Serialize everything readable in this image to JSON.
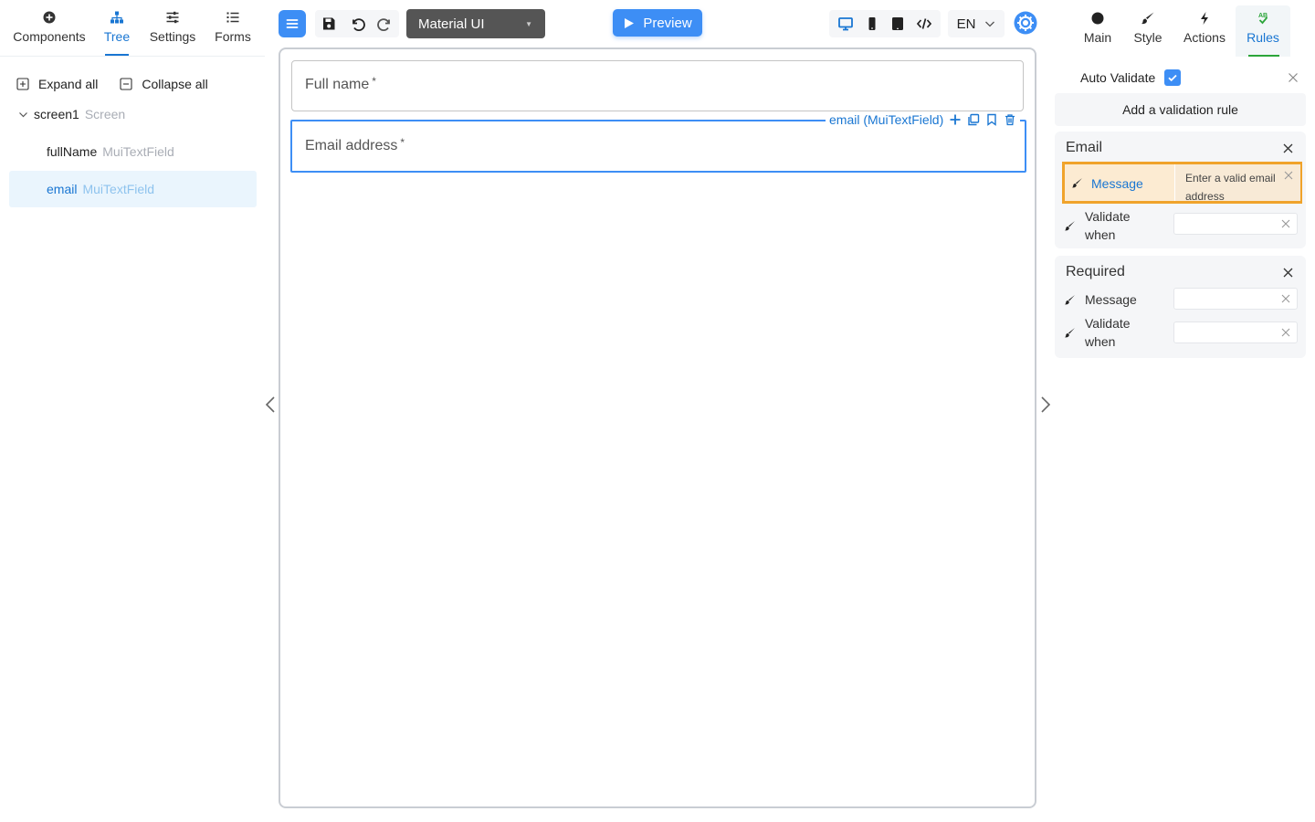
{
  "left_panel": {
    "tabs": [
      {
        "label": "Components",
        "icon": "plus-circle-icon"
      },
      {
        "label": "Tree",
        "icon": "sitemap-icon",
        "active": true
      },
      {
        "label": "Settings",
        "icon": "sliders-icon"
      },
      {
        "label": "Forms",
        "icon": "list-icon"
      }
    ],
    "expand_all": "Expand all",
    "collapse_all": "Collapse all",
    "tree": {
      "screen": {
        "name": "screen1",
        "type": "Screen"
      },
      "items": [
        {
          "name": "fullName",
          "type": "MuiTextField"
        },
        {
          "name": "email",
          "type": "MuiTextField",
          "selected": true
        }
      ]
    }
  },
  "toolbar": {
    "ui_library": "Material UI",
    "preview_label": "Preview",
    "language": "EN"
  },
  "canvas": {
    "fields": [
      {
        "label": "Full name",
        "required_mark": "*"
      },
      {
        "label": "Email address",
        "required_mark": "*"
      }
    ],
    "selection_label": "email (MuiTextField)"
  },
  "right_panel": {
    "tabs": [
      {
        "label": "Main",
        "icon": "circle-icon"
      },
      {
        "label": "Style",
        "icon": "brush-icon"
      },
      {
        "label": "Actions",
        "icon": "bolt-icon"
      },
      {
        "label": "Rules",
        "icon": "ab-check-icon",
        "active": true
      }
    ],
    "auto_validate_label": "Auto Validate",
    "auto_validate_checked": true,
    "add_rule_label": "Add a validation rule",
    "rules": [
      {
        "title": "Email",
        "message_label": "Message",
        "message_value": "Enter a valid email address",
        "validate_when_label": "Validate when",
        "validate_when_value": ""
      },
      {
        "title": "Required",
        "message_label": "Message",
        "message_value": "",
        "validate_when_label": "Validate when",
        "validate_when_value": ""
      }
    ]
  },
  "colors": {
    "accent": "#3d8ef5",
    "active_tab": "#1976d2",
    "rules_underline": "#2ca53a",
    "highlight_border": "#f0a32b"
  }
}
